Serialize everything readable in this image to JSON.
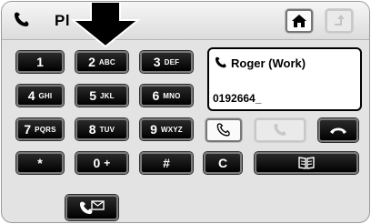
{
  "header": {
    "title": "Pl",
    "home_icon": "home-icon",
    "back_icon": "back-arrow-icon"
  },
  "keypad": [
    {
      "digit": "1",
      "letters": ""
    },
    {
      "digit": "2",
      "letters": "ABC"
    },
    {
      "digit": "3",
      "letters": "DEF"
    },
    {
      "digit": "4",
      "letters": "GHI"
    },
    {
      "digit": "5",
      "letters": "JKL"
    },
    {
      "digit": "6",
      "letters": "MNO"
    },
    {
      "digit": "7",
      "letters": "PQRS"
    },
    {
      "digit": "8",
      "letters": "TUV"
    },
    {
      "digit": "9",
      "letters": "WXYZ"
    },
    {
      "digit": "*",
      "letters": ""
    },
    {
      "digit": "0",
      "letters": "+"
    },
    {
      "digit": "#",
      "letters": ""
    }
  ],
  "clear_label": "C",
  "display": {
    "contact": "Roger  (Work)",
    "number": "0192664_"
  },
  "colors": {
    "button_bg": "#000000",
    "button_text": "#ffffff",
    "screen_bg": "#e3e3e3"
  }
}
